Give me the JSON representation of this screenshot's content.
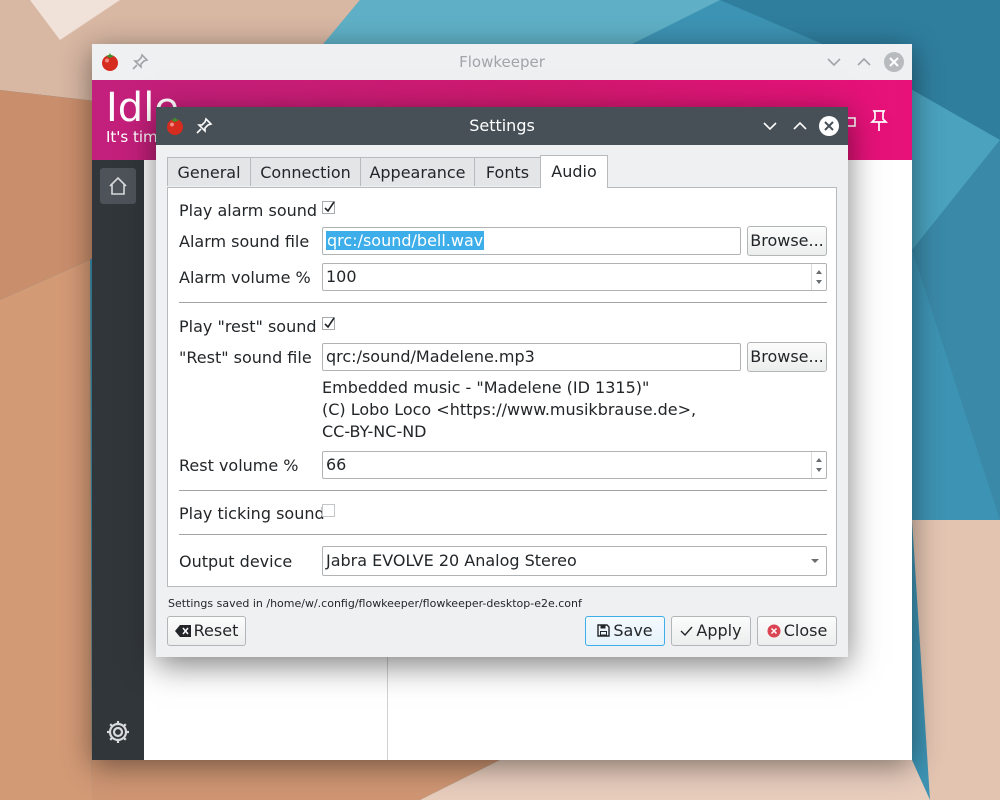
{
  "main_window": {
    "title": "Flowkeeper",
    "header": {
      "title": "Idle",
      "subtitle": "It's time"
    }
  },
  "dialog": {
    "title": "Settings",
    "tabs": [
      {
        "label": "General"
      },
      {
        "label": "Connection"
      },
      {
        "label": "Appearance"
      },
      {
        "label": "Fonts"
      },
      {
        "label": "Audio"
      }
    ],
    "active_tab": "Audio",
    "audio": {
      "play_alarm_label": "Play alarm sound",
      "play_alarm_checked": true,
      "alarm_file_label": "Alarm sound file",
      "alarm_file_value": "qrc:/sound/bell.wav",
      "alarm_volume_label": "Alarm volume %",
      "alarm_volume_value": "100",
      "play_rest_label": "Play \"rest\" sound",
      "play_rest_checked": true,
      "rest_file_label": "\"Rest\" sound file",
      "rest_file_value": "qrc:/sound/Madelene.mp3",
      "rest_info_lines": [
        "Embedded music - \"Madelene (ID 1315)\"",
        "(C) Lobo Loco <https://www.musikbrause.de>,",
        "CC-BY-NC-ND"
      ],
      "rest_volume_label": "Rest volume %",
      "rest_volume_value": "66",
      "play_ticking_label": "Play ticking sound",
      "play_ticking_checked": false,
      "output_device_label": "Output device",
      "output_device_value": "Jabra EVOLVE 20 Analog Stereo",
      "browse_label": "Browse..."
    },
    "status_text": "Settings saved in /home/w/.config/flowkeeper/flowkeeper-desktop-e2e.conf",
    "buttons": {
      "reset": "Reset",
      "save": "Save",
      "apply": "Apply",
      "close": "Close"
    }
  },
  "colors": {
    "header_magenta": "#d0196f",
    "titlebar_dark": "#475057",
    "selection_blue": "#3daee9",
    "sidebar_dark": "#31363b"
  }
}
